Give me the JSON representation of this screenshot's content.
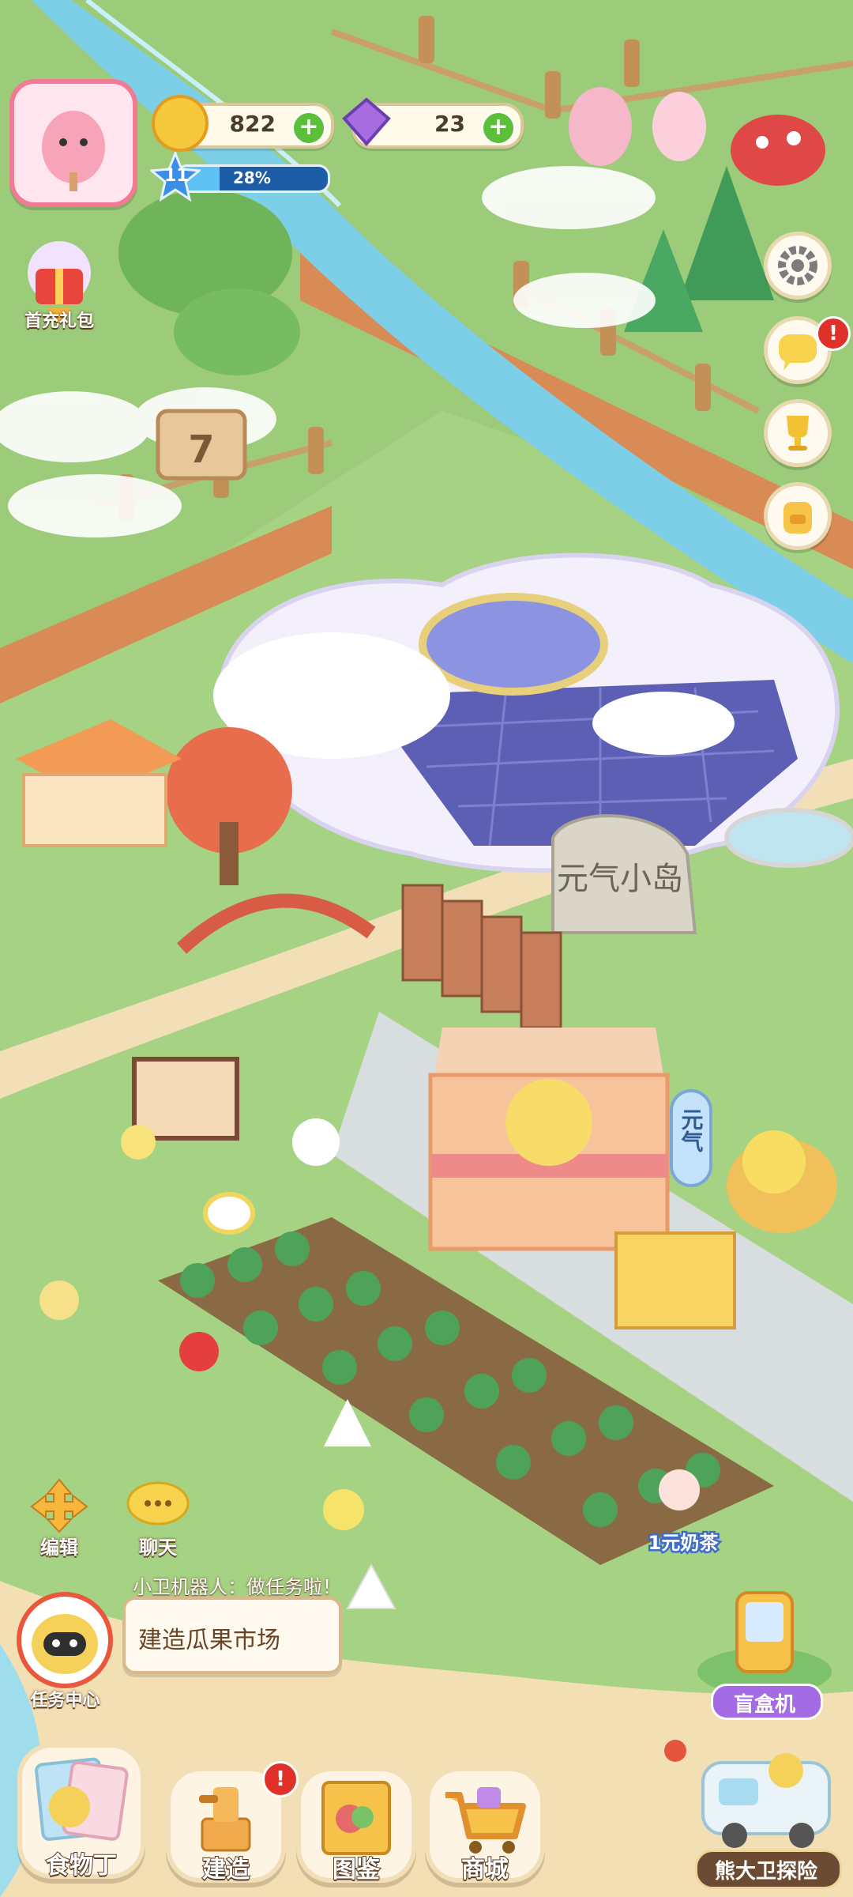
{
  "hud": {
    "coins": "822",
    "gems": "23",
    "level": "11",
    "level_progress": "28%",
    "level_progress_fraction": 0.28,
    "first_charge_label": "首充礼包"
  },
  "map": {
    "sign_number": "7",
    "island_stone_text": "元气小岛",
    "shop_sign_text": "元气",
    "milk_tea_label": "1元奶茶"
  },
  "left_tools": {
    "edit_label": "编辑",
    "chat_label": "聊天"
  },
  "task": {
    "speaker_line": "小卫机器人：做任务啦！",
    "task_text": "建造瓜果市场",
    "center_label": "任务中心"
  },
  "right_side": {
    "blind_box_label": "盲盒机",
    "explore_label": "熊大卫探险"
  },
  "bottom_nav": {
    "food_label": "食物丁",
    "build_label": "建造",
    "collection_label": "图鉴",
    "shop_label": "商城",
    "build_badge": "!"
  },
  "badges": {
    "chat_badge": "!"
  }
}
